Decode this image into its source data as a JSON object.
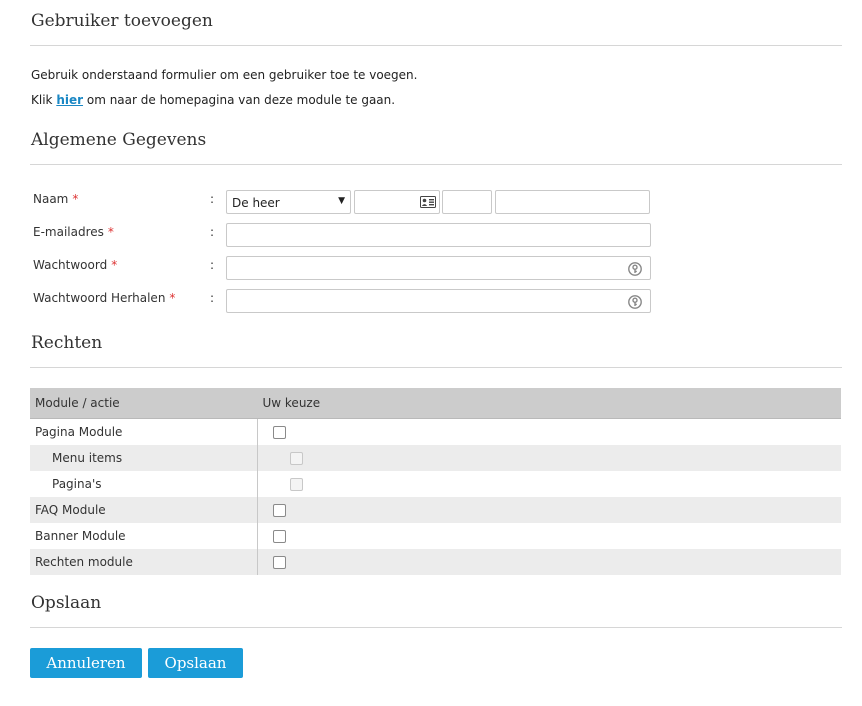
{
  "title": "Gebruiker toevoegen",
  "intro": {
    "line1": "Gebruik onderstaand formulier om een gebruiker toe te voegen.",
    "line2_prefix": "Klik ",
    "line2_link": "hier",
    "line2_suffix": " om naar de homepagina van deze module te gaan."
  },
  "sections": {
    "general": "Algemene Gegevens",
    "rights": "Rechten",
    "save": "Opslaan"
  },
  "form": {
    "colon": ":",
    "required_marker": "*",
    "name_label": "Naam",
    "salutation_value": "De heer",
    "email_label": "E-mailadres",
    "password_label": "Wachtwoord",
    "password_repeat_label": "Wachtwoord Herhalen"
  },
  "rights_table": {
    "headers": [
      "Module / actie",
      "Uw keuze"
    ],
    "rows": [
      {
        "label": "Pagina Module",
        "sub": false,
        "checked": false,
        "disabled": false
      },
      {
        "label": "Menu items",
        "sub": true,
        "checked": false,
        "disabled": true
      },
      {
        "label": "Pagina's",
        "sub": true,
        "checked": false,
        "disabled": true
      },
      {
        "label": "FAQ Module",
        "sub": false,
        "checked": false,
        "disabled": false
      },
      {
        "label": "Banner Module",
        "sub": false,
        "checked": false,
        "disabled": false
      },
      {
        "label": "Rechten module",
        "sub": false,
        "checked": false,
        "disabled": false
      }
    ]
  },
  "buttons": {
    "cancel": "Annuleren",
    "save": "Opslaan"
  },
  "icons": {
    "salutation_dropdown": "caret-down-icon",
    "contact_card": "id-card-icon",
    "password_key": "key-icon"
  },
  "colors": {
    "accent": "#1b9cd8",
    "link": "#1a87c4",
    "required": "#dd3333",
    "table_header": "#cccccc"
  }
}
